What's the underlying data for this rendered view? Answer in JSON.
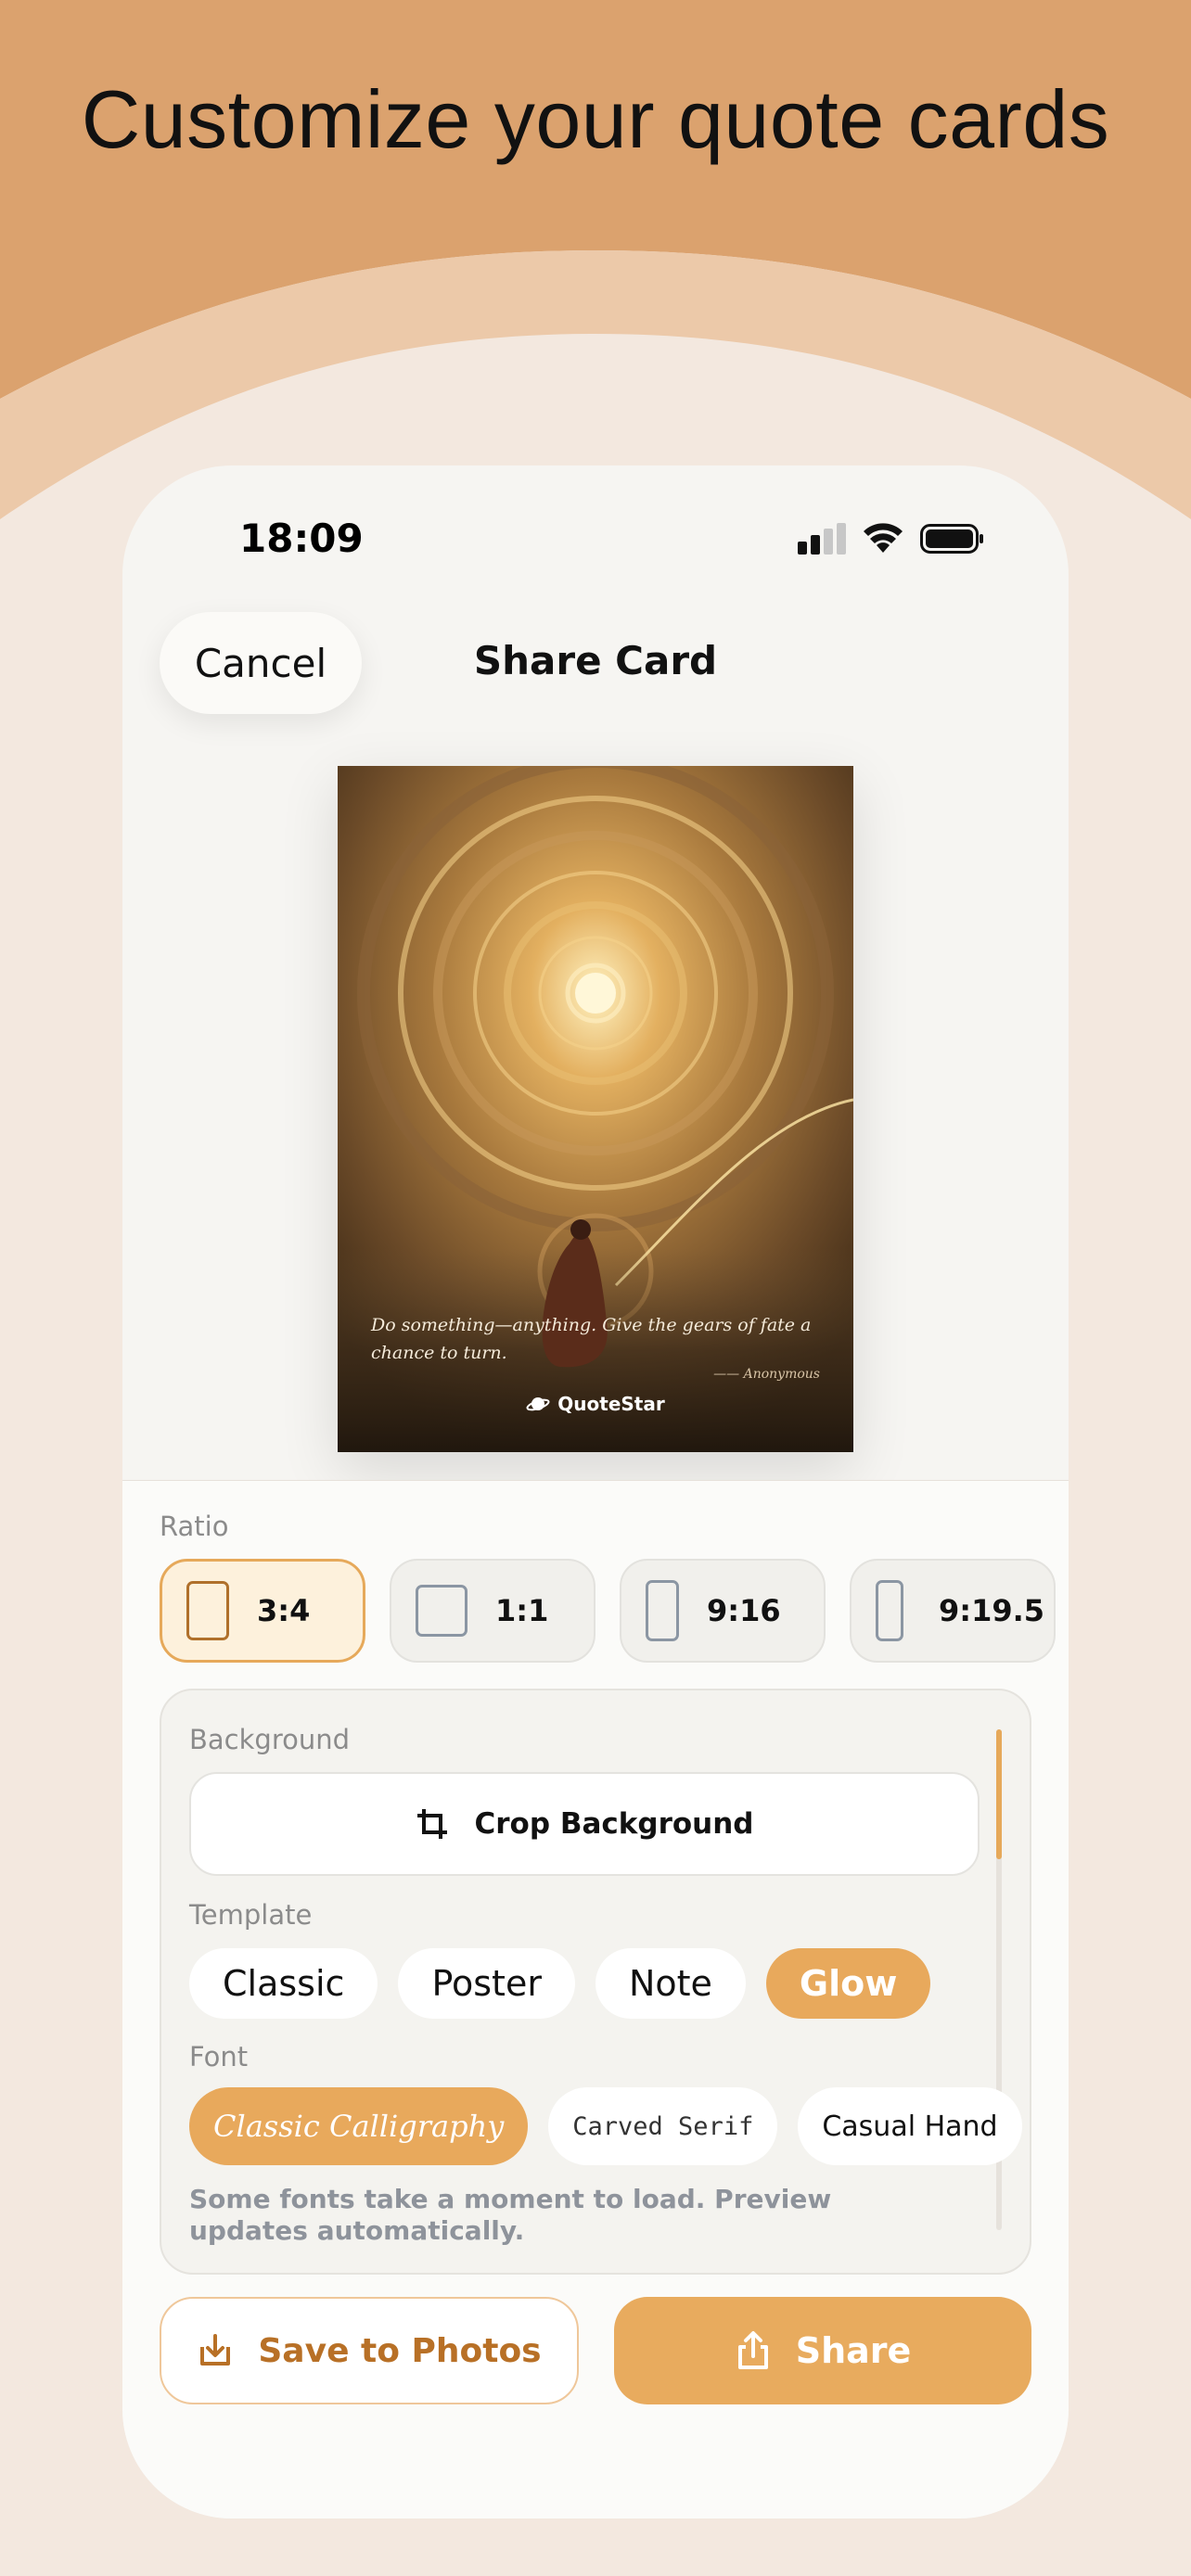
{
  "promo": {
    "headline": "Customize your quote cards",
    "colors": {
      "top": "#dba26e",
      "middle_arc": "#ecc9a9",
      "inner_arc": "#f4e6d9"
    }
  },
  "status_bar": {
    "time": "18:09",
    "icons": [
      "signal-icon",
      "wifi-icon",
      "battery-icon"
    ]
  },
  "nav": {
    "cancel_label": "Cancel",
    "title": "Share Card"
  },
  "card": {
    "quote": "Do something—anything. Give the gears of fate a chance to turn.",
    "author": "Anonymous",
    "brand": "QuoteStar",
    "image": "golden-clockwork-portal-illustration"
  },
  "ratio": {
    "label": "Ratio",
    "options": [
      {
        "label": "3:4",
        "selected": true
      },
      {
        "label": "1:1",
        "selected": false
      },
      {
        "label": "9:16",
        "selected": false
      },
      {
        "label": "9:19.5",
        "selected": false
      }
    ]
  },
  "background": {
    "label": "Background",
    "crop_label": "Crop Background"
  },
  "template": {
    "label": "Template",
    "options": [
      {
        "label": "Classic",
        "selected": false
      },
      {
        "label": "Poster",
        "selected": false
      },
      {
        "label": "Note",
        "selected": false
      },
      {
        "label": "Glow",
        "selected": true
      }
    ]
  },
  "font": {
    "label": "Font",
    "options": [
      {
        "label": "Classic Calligraphy",
        "selected": true
      },
      {
        "label": "Carved Serif",
        "selected": false
      },
      {
        "label": "Casual Hand",
        "selected": false
      }
    ],
    "hint": "Some fonts take a moment to load. Preview updates automatically."
  },
  "actions": {
    "save_label": "Save to Photos",
    "share_label": "Share"
  },
  "accent_color": "#e8ab5e"
}
